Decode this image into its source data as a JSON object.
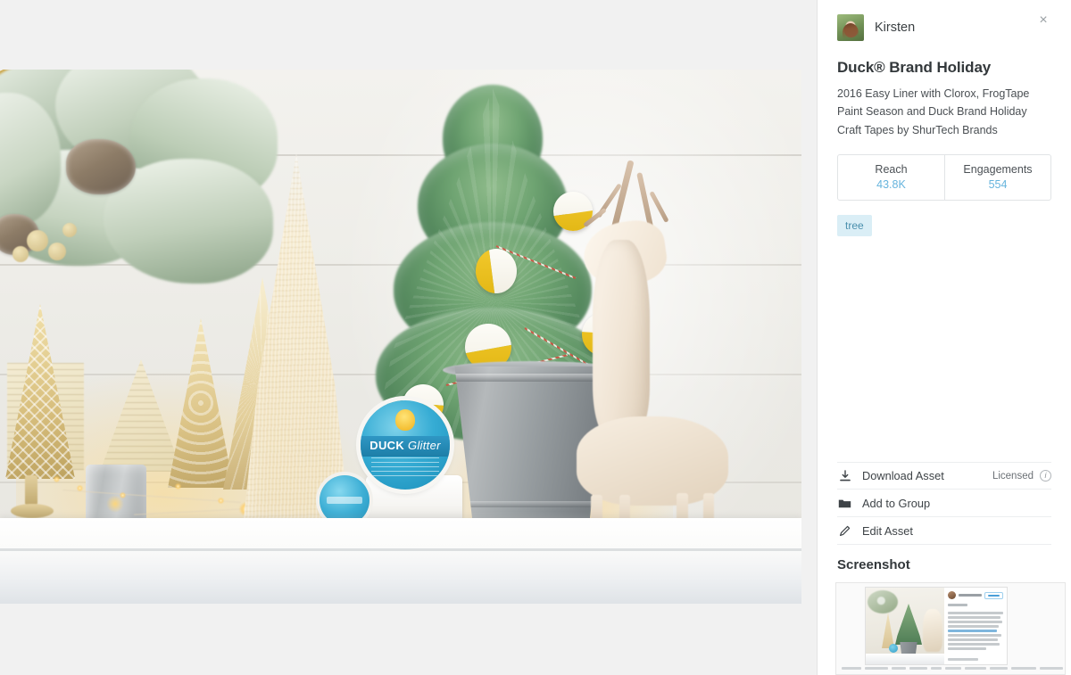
{
  "panel": {
    "author": "Kirsten",
    "close_label": "×",
    "title": "Duck® Brand Holiday",
    "description": "2016 Easy Liner with Clorox, FrogTape Paint Season and Duck Brand Holiday Craft Tapes by ShurTech Brands",
    "stats": [
      {
        "label": "Reach",
        "value": "43.8K"
      },
      {
        "label": "Engagements",
        "value": "554"
      }
    ],
    "tags": [
      "tree"
    ],
    "actions": [
      {
        "icon": "download-icon",
        "label": "Download Asset",
        "right_label": "Licensed",
        "info": "i"
      },
      {
        "icon": "folder-icon",
        "label": "Add to Group"
      },
      {
        "icon": "pencil-icon",
        "label": "Edit Asset"
      }
    ],
    "screenshot_section_title": "Screenshot"
  },
  "asset": {
    "alt": "Holiday mantel styled with flocked wreath, gold mercury-glass trees, a cream sisal tree, a small green Christmas tree in a galvanized bucket decorated with white-and-yellow half-dipped ornaments, Duck Glitter craft tape, and a cream reindeer figurine",
    "brand_label_primary": "DUCK",
    "brand_label_secondary": "Glitter"
  },
  "colors": {
    "accent_blue": "#66b4dd",
    "tag_background": "#daeef6",
    "tag_text": "#4a8fad",
    "panel_background": "#ffffff",
    "viewer_background": "#f1f1f1",
    "text_primary": "#33383b",
    "ornament_gold": "#f2c82b"
  }
}
